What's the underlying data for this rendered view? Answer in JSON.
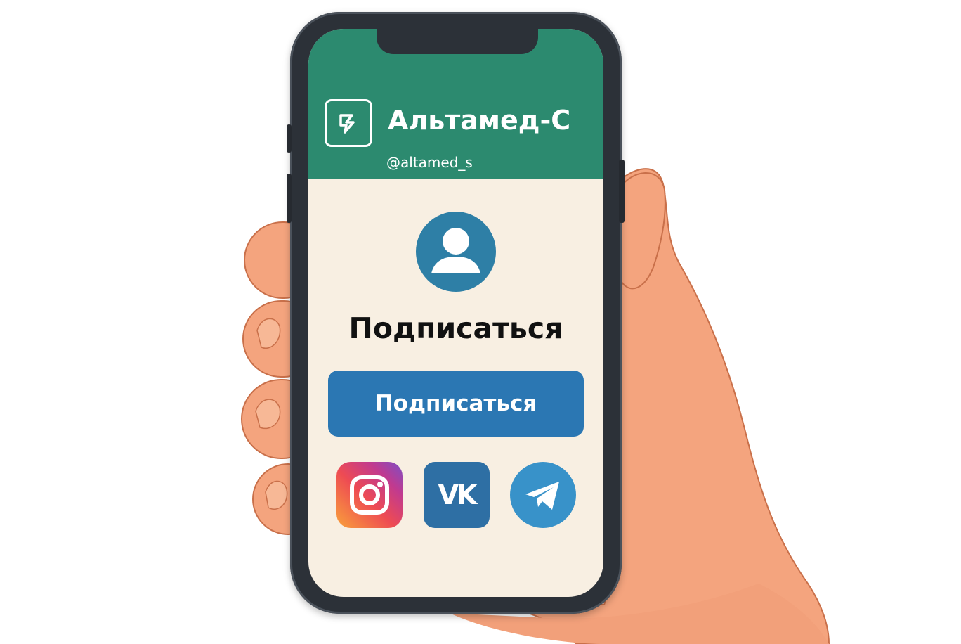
{
  "header": {
    "brand_name": "Альтамед-С",
    "handle": "@altamed_s",
    "logo_icon": "altamed-logo-icon"
  },
  "profile": {
    "avatar_icon": "user-avatar-icon",
    "title": "Подписаться"
  },
  "subscribe_button": {
    "label": "Подписаться"
  },
  "social_links": [
    {
      "name": "instagram",
      "icon": "instagram-icon"
    },
    {
      "name": "vk",
      "icon": "vk-icon",
      "label": "VK"
    },
    {
      "name": "telegram",
      "icon": "telegram-icon"
    }
  ],
  "colors": {
    "header_bg": "#2c8a6f",
    "screen_bg": "#f8efe2",
    "button_bg": "#2b77b3",
    "avatar_bg": "#2e7fa6",
    "phone_frame": "#2c3138",
    "skin": "#f4a47e"
  }
}
